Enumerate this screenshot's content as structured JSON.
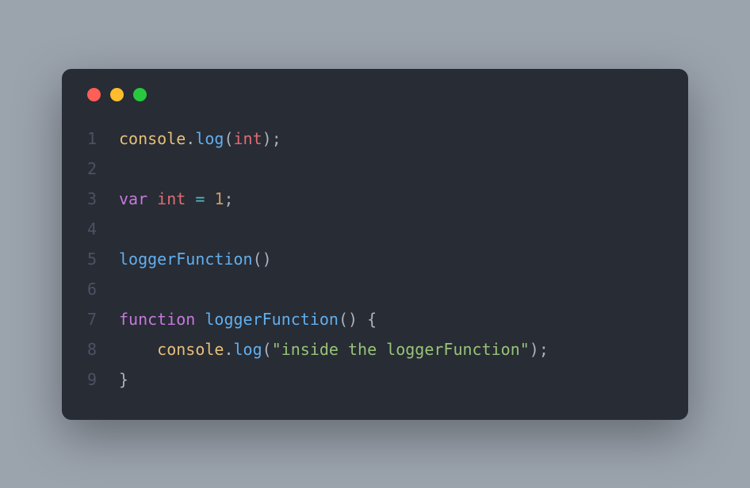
{
  "window": {
    "traffic_lights": {
      "close": "close",
      "minimize": "minimize",
      "maximize": "maximize"
    }
  },
  "code": {
    "lines": [
      {
        "num": "1"
      },
      {
        "num": "2"
      },
      {
        "num": "3"
      },
      {
        "num": "4"
      },
      {
        "num": "5"
      },
      {
        "num": "6"
      },
      {
        "num": "7"
      },
      {
        "num": "8"
      },
      {
        "num": "9"
      }
    ],
    "tokens": {
      "l1": {
        "console": "console",
        "dot": ".",
        "log": "log",
        "lp": "(",
        "int": "int",
        "rp": ")",
        "semi": ";"
      },
      "l3": {
        "var": "var",
        "sp": " ",
        "int": "int",
        "sp2": " ",
        "eq": "=",
        "sp3": " ",
        "one": "1",
        "semi": ";"
      },
      "l5": {
        "fn": "loggerFunction",
        "lp": "(",
        "rp": ")"
      },
      "l7": {
        "function": "function",
        "sp": " ",
        "name": "loggerFunction",
        "lp": "(",
        "rp": ")",
        "sp2": " ",
        "lb": "{"
      },
      "l8": {
        "indent": "    ",
        "console": "console",
        "dot": ".",
        "log": "log",
        "lp": "(",
        "str": "\"inside the loggerFunction\"",
        "rp": ")",
        "semi": ";"
      },
      "l9": {
        "rb": "}"
      }
    }
  }
}
